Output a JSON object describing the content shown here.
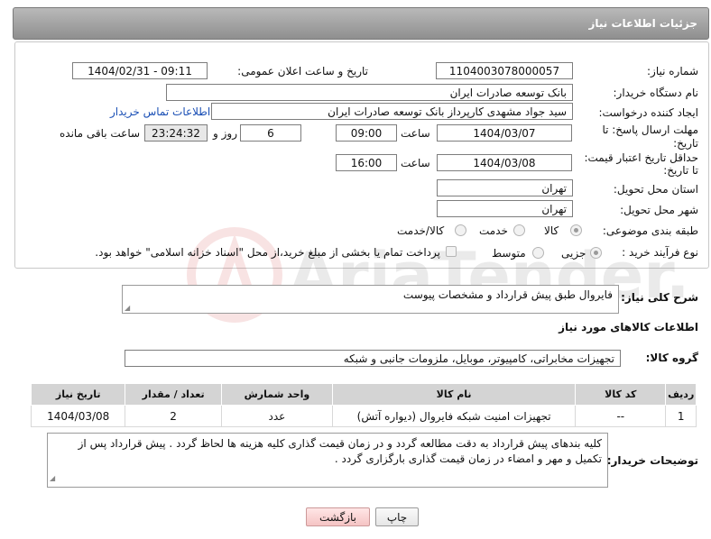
{
  "header": {
    "title": "جزئیات اطلاعات نیاز"
  },
  "fields": {
    "need_number_label": "شماره نیاز:",
    "need_number": "1104003078000057",
    "announce_label": "تاریخ و ساعت اعلان عمومی:",
    "announce_value": "1404/02/31 - 09:11",
    "buyer_org_label": "نام دستگاه خریدار:",
    "buyer_org": "بانک توسعه صادرات ایران",
    "creator_label": "ایجاد کننده درخواست:",
    "creator": "سید جواد مشهدی کارپرداز بانک توسعه صادرات ایران",
    "contact_link": "اطلاعات تماس خریدار",
    "deadline_label_1": "مهلت ارسال پاسخ: تا",
    "deadline_label_2": "تاریخ:",
    "deadline_date": "1404/03/07",
    "time_word": "ساعت",
    "deadline_time": "09:00",
    "days_value": "6",
    "days_word": "روز و",
    "remaining_time": "23:24:32",
    "remaining_word": "ساعت باقی مانده",
    "validity_label_1": "حداقل تاریخ اعتبار قیمت:",
    "validity_label_2": "تا تاریخ:",
    "validity_date": "1404/03/08",
    "validity_time": "16:00",
    "province_label": "استان محل تحویل:",
    "province": "تهران",
    "city_label": "شهر محل تحویل:",
    "city": "تهران",
    "category_label": "طبقه بندی موضوعی:",
    "category_options": [
      "کالا",
      "خدمت",
      "کالا/خدمت"
    ],
    "process_label": "نوع فرآیند خرید :",
    "process_options": [
      "جزیی",
      "متوسط"
    ],
    "payment_note": "پرداخت تمام یا بخشی از مبلغ خرید،از محل \"اسناد خزانه اسلامی\" خواهد بود."
  },
  "summary": {
    "label": "شرح کلی نیاز:",
    "value": "فایروال طبق پیش قرارداد و مشخصات پیوست"
  },
  "goods": {
    "section_title": "اطلاعات کالاهای مورد نیاز",
    "group_label": "گروه کالا:",
    "group_value": "تجهیزات مخابراتی، کامپیوتر، موبایل، ملزومات جانبی و شبکه",
    "columns": [
      "ردیف",
      "کد کالا",
      "نام کالا",
      "واحد شمارش",
      "تعداد / مقدار",
      "تاریخ نیاز"
    ],
    "rows": [
      [
        "1",
        "--",
        "تجهیزات امنیت شبکه فایروال (دیواره آتش)",
        "عدد",
        "2",
        "1404/03/08"
      ]
    ]
  },
  "buyer_notes": {
    "label": "توضیحات خریدار:",
    "value": "کلیه بندهای پیش قرارداد به دقت مطالعه گردد و در زمان قیمت گذاری کلیه هزینه ها لحاظ گردد . پیش قرارداد پس از تکمیل و مهر و امضاء در زمان قیمت گذاری بارگزاری گردد ."
  },
  "buttons": {
    "print": "چاپ",
    "back": "بازگشت"
  },
  "watermark": {
    "text": "AriaTender.net"
  },
  "colors": {
    "header_bg": "#a3a3a3",
    "link": "#1a4fb5",
    "back_button": "#f5c4c4"
  }
}
